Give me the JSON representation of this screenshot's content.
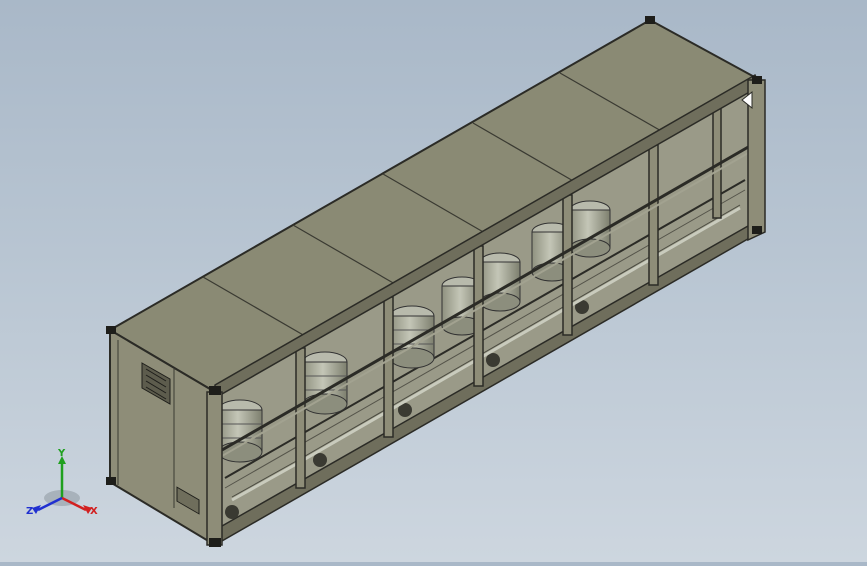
{
  "viewport": {
    "background_top": "#a9b8c8",
    "background_bottom": "#cdd6df",
    "model": {
      "body_color": "#8e8d78",
      "top_color": "#8a8a74",
      "frame_color": "#2b2b26",
      "tank_color": "#a7a99a",
      "bays": 6
    }
  },
  "triad": {
    "x_label": "X",
    "y_label": "Y",
    "z_label": "Z",
    "x_color": "#d22020",
    "y_color": "#1fa01f",
    "z_color": "#2030d0"
  }
}
